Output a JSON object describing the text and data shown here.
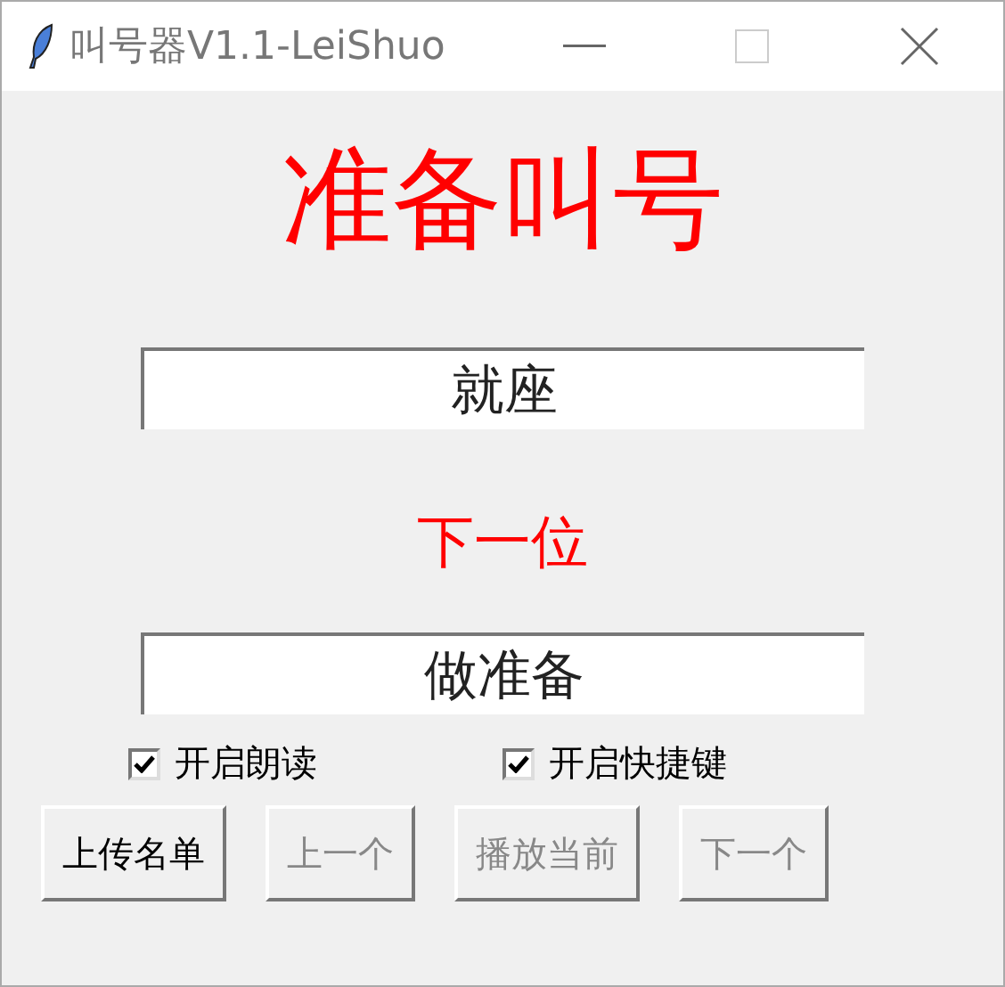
{
  "window": {
    "title": "叫号器V1.1-LeiShuo"
  },
  "heading": "准备叫号",
  "current_field": {
    "value": "就座"
  },
  "next_label": "下一位",
  "next_field": {
    "value": "做准备"
  },
  "checkboxes": [
    {
      "label": "开启朗读",
      "checked": true
    },
    {
      "label": "开启快捷键",
      "checked": true
    }
  ],
  "buttons": [
    {
      "label": "上传名单",
      "disabled": false
    },
    {
      "label": "上一个",
      "disabled": true
    },
    {
      "label": "播放当前",
      "disabled": true
    },
    {
      "label": "下一个",
      "disabled": true
    }
  ]
}
